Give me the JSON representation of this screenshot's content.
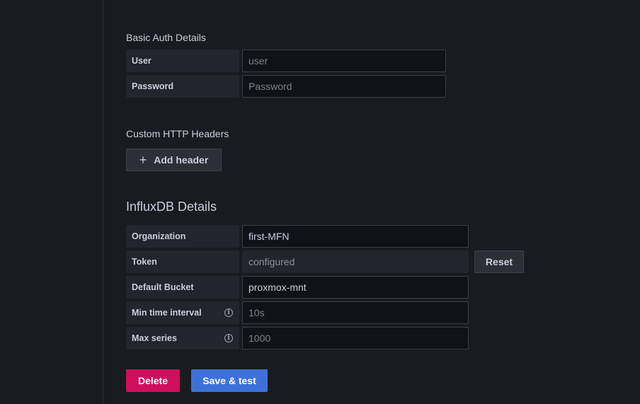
{
  "basic_auth": {
    "title": "Basic Auth Details",
    "user_label": "User",
    "user_placeholder": "user",
    "password_label": "Password",
    "password_placeholder": "Password"
  },
  "custom_headers": {
    "title": "Custom HTTP Headers",
    "add_header_icon": "plus-icon",
    "add_header_label": "Add header"
  },
  "influx": {
    "title": "InfluxDB Details",
    "organization_label": "Organization",
    "organization_value": "first-MFN",
    "token_label": "Token",
    "token_value": "configured",
    "reset_label": "Reset",
    "bucket_label": "Default Bucket",
    "bucket_value": "proxmox-mnt",
    "min_interval_label": "Min time interval",
    "min_interval_placeholder": "10s",
    "max_series_label": "Max series",
    "max_series_placeholder": "1000",
    "info_icon": "info-icon"
  },
  "actions": {
    "delete_label": "Delete",
    "save_label": "Save & test"
  },
  "colors": {
    "background": "#181b1f",
    "danger": "#d10e5c",
    "primary": "#3d71d9"
  }
}
